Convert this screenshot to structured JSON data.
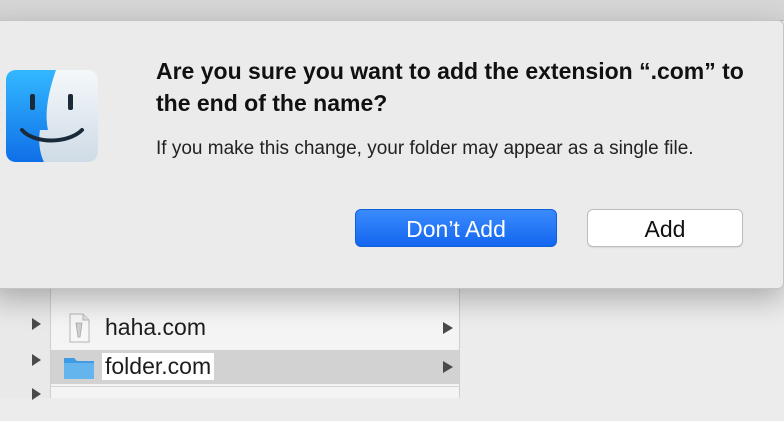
{
  "dialog": {
    "title": "Are you sure you want to add the extension “.com” to the end of the name?",
    "message": "If you make this change, your folder may appear as a single file.",
    "primary_button": "Don’t Add",
    "secondary_button": "Add",
    "app_icon": "finder-icon"
  },
  "finder": {
    "files": [
      {
        "name": "haha.com",
        "icon": "document-icon",
        "selected": false
      },
      {
        "name": "folder.com",
        "icon": "folder-icon",
        "selected": true
      }
    ]
  },
  "colors": {
    "accent": "#1a6ff4",
    "folder": "#5aaee9"
  }
}
